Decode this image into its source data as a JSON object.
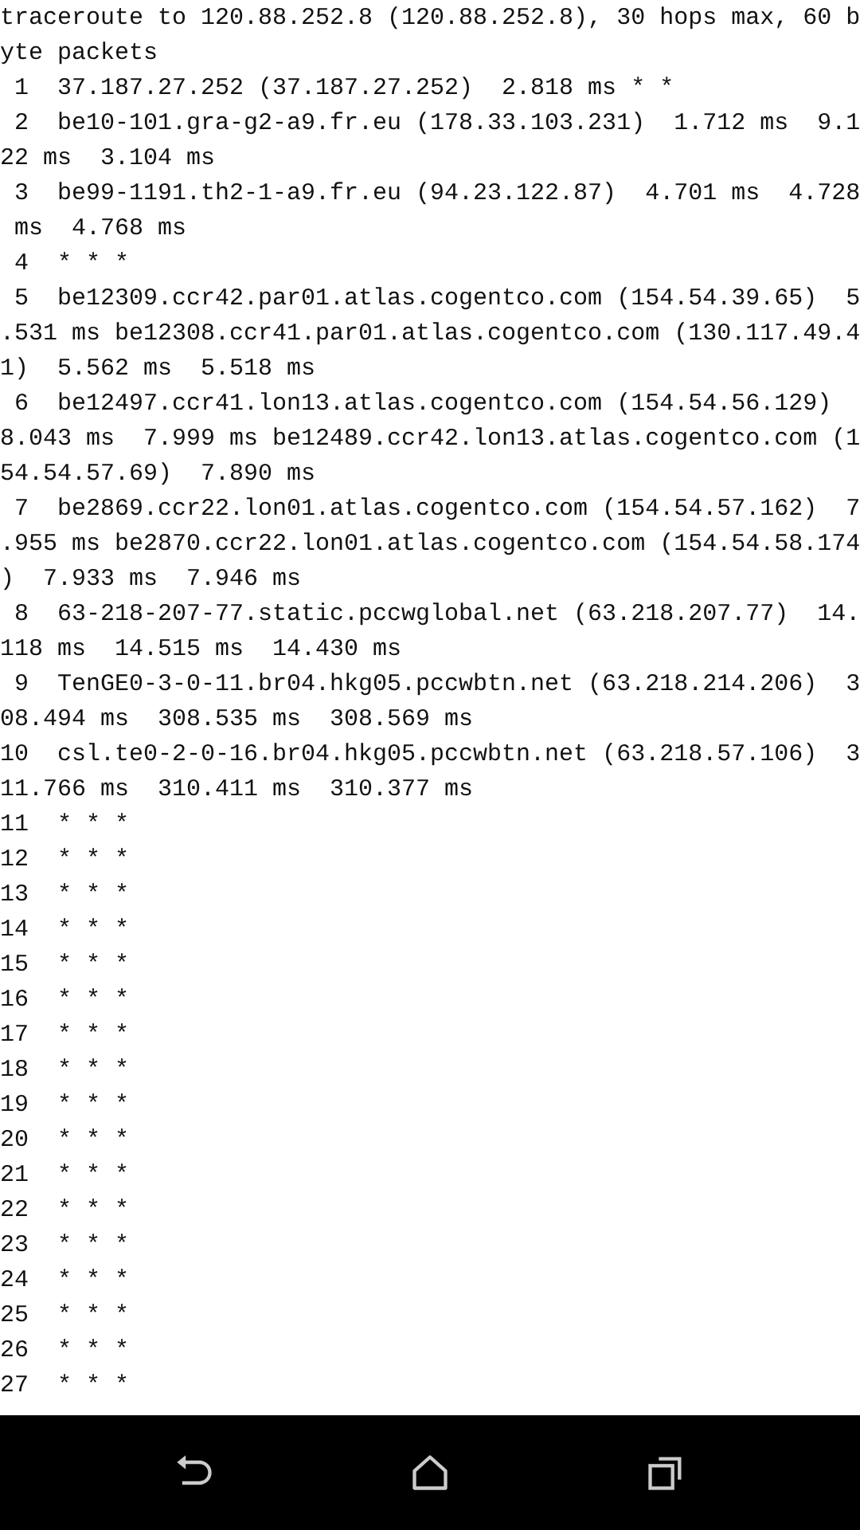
{
  "terminal": {
    "lines": [
      "traceroute to 120.88.252.8 (120.88.252.8), 30 hops max, 60 b",
      "yte packets",
      " 1  37.187.27.252 (37.187.27.252)  2.818 ms * *",
      " 2  be10-101.gra-g2-a9.fr.eu (178.33.103.231)  1.712 ms  9.1",
      "22 ms  3.104 ms",
      " 3  be99-1191.th2-1-a9.fr.eu (94.23.122.87)  4.701 ms  4.728",
      " ms  4.768 ms",
      " 4  * * *",
      " 5  be12309.ccr42.par01.atlas.cogentco.com (154.54.39.65)  5",
      ".531 ms be12308.ccr41.par01.atlas.cogentco.com (130.117.49.4",
      "1)  5.562 ms  5.518 ms",
      " 6  be12497.ccr41.lon13.atlas.cogentco.com (154.54.56.129)",
      "8.043 ms  7.999 ms be12489.ccr42.lon13.atlas.cogentco.com (1",
      "54.54.57.69)  7.890 ms",
      " 7  be2869.ccr22.lon01.atlas.cogentco.com (154.54.57.162)  7",
      ".955 ms be2870.ccr22.lon01.atlas.cogentco.com (154.54.58.174",
      ")  7.933 ms  7.946 ms",
      " 8  63-218-207-77.static.pccwglobal.net (63.218.207.77)  14.",
      "118 ms  14.515 ms  14.430 ms",
      " 9  TenGE0-3-0-11.br04.hkg05.pccwbtn.net (63.218.214.206)  3",
      "08.494 ms  308.535 ms  308.569 ms",
      "10  csl.te0-2-0-16.br04.hkg05.pccwbtn.net (63.218.57.106)  3",
      "11.766 ms  310.411 ms  310.377 ms",
      "11  * * *",
      "12  * * *",
      "13  * * *",
      "14  * * *",
      "15  * * *",
      "16  * * *",
      "17  * * *",
      "18  * * *",
      "19  * * *",
      "20  * * *",
      "21  * * *",
      "22  * * *",
      "23  * * *",
      "24  * * *",
      "25  * * *",
      "26  * * *",
      "27  * * *"
    ]
  },
  "nav_bar": {
    "buttons": [
      {
        "kind": "back"
      },
      {
        "kind": "home"
      },
      {
        "kind": "recents"
      }
    ]
  }
}
